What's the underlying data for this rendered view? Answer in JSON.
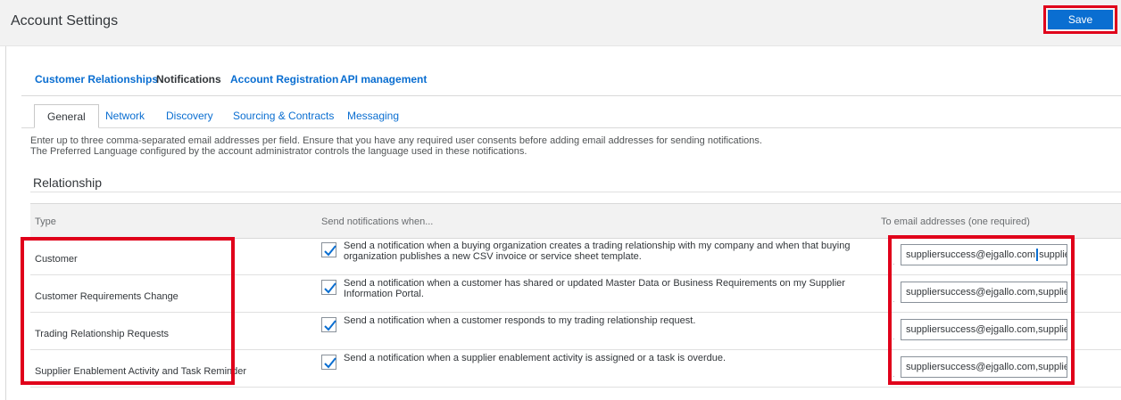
{
  "header": {
    "title": "Account Settings",
    "save_label": "Save"
  },
  "top_tabs": [
    {
      "label": "Customer Relationships",
      "active": false
    },
    {
      "label": "Notifications",
      "active": true
    },
    {
      "label": "Account Registration",
      "active": false
    },
    {
      "label": "API management",
      "active": false
    }
  ],
  "sub_tabs": [
    {
      "label": "General",
      "active": true
    },
    {
      "label": "Network",
      "active": false
    },
    {
      "label": "Discovery",
      "active": false
    },
    {
      "label": "Sourcing & Contracts",
      "active": false
    },
    {
      "label": "Messaging",
      "active": false
    }
  ],
  "help_text": {
    "line1": "Enter up to three comma-separated email addresses per field. Ensure that you have any required user consents before adding email addresses for sending notifications.",
    "line2": "The Preferred Language configured by the account administrator controls the language used in these notifications."
  },
  "section": {
    "title": "Relationship"
  },
  "table": {
    "headers": {
      "type": "Type",
      "send": "Send notifications when...",
      "email": "To email addresses (one required)"
    },
    "rows": [
      {
        "type": "Customer",
        "checked": true,
        "description": "Send a notification when a buying organization creates a trading relationship with my company and when that buying organization publishes a new CSV invoice or service sheet template.",
        "email_before_caret": "suppliersuccess@ejgallo.com",
        "email_after_caret": "suppliersu"
      },
      {
        "type": "Customer Requirements Change",
        "checked": true,
        "description": "Send a notification when a customer has shared or updated Master Data or Business Requirements on my Supplier Information Portal.",
        "email_before_caret": "suppliersuccess@ejgallo.com,suppliersu",
        "email_after_caret": ""
      },
      {
        "type": "Trading Relationship Requests",
        "checked": true,
        "description": "Send a notification when a customer responds to my trading relationship request.",
        "email_before_caret": "suppliersuccess@ejgallo.com,suppliersu",
        "email_after_caret": ""
      },
      {
        "type": "Supplier Enablement Activity and Task Reminder",
        "checked": true,
        "description": "Send a notification when a supplier enablement activity is assigned or a task is overdue.",
        "email_before_caret": "suppliersuccess@ejgallo.com,suppliersu",
        "email_after_caret": ""
      }
    ]
  },
  "colors": {
    "accent": "#0a6ed1",
    "highlight": "#e0001a",
    "header_bg": "#f2f2f2"
  }
}
